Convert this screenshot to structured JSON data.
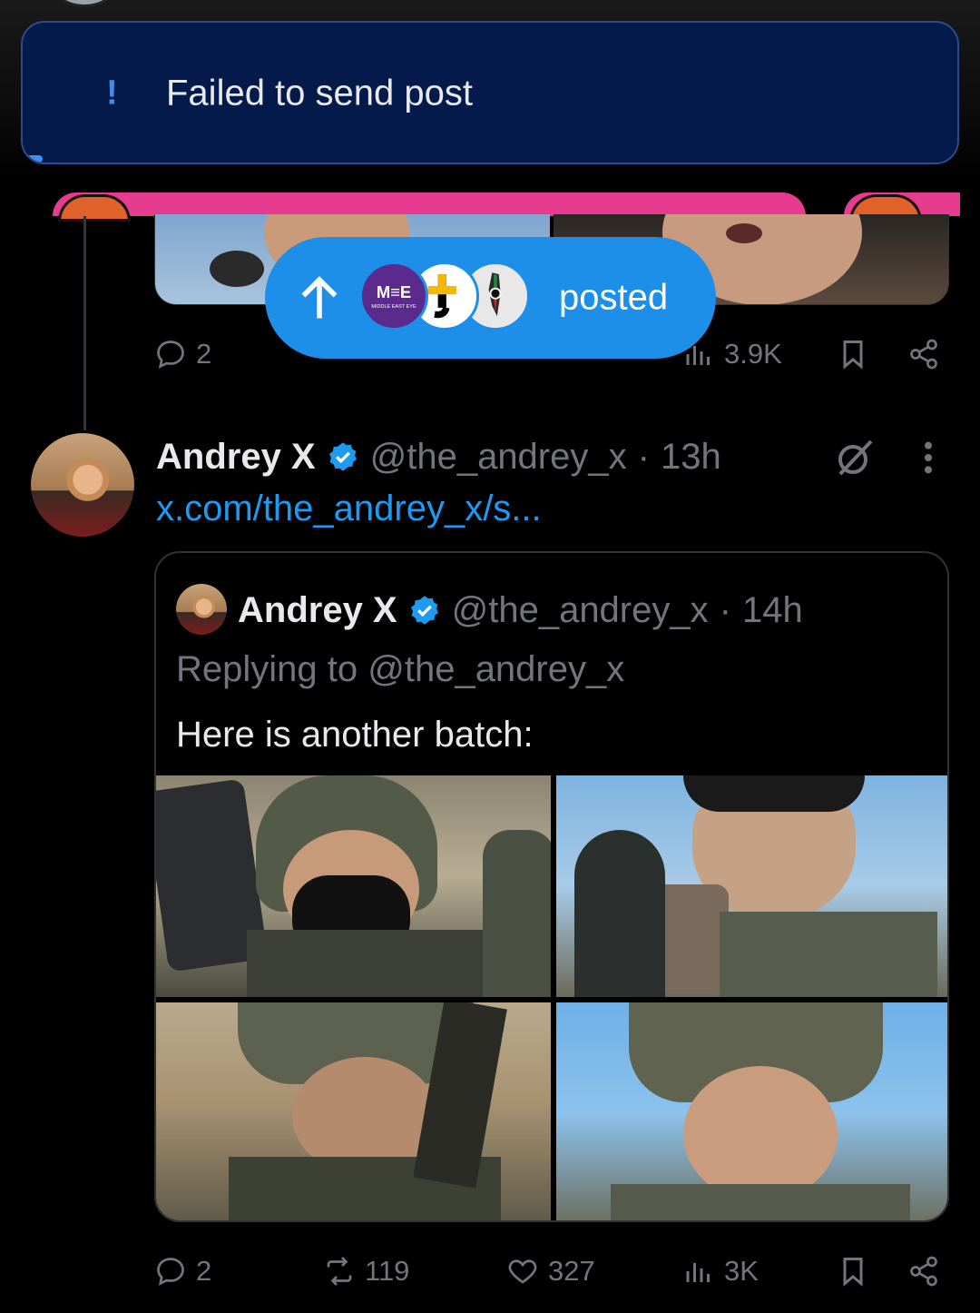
{
  "toast": {
    "icon": "exclamation-icon",
    "message": "Failed to send post"
  },
  "posted_pill": {
    "icon": "arrow-up-icon",
    "label": "posted",
    "avatars": [
      "MIDDLE EAST EYE",
      "AJ+",
      "palestine-map-icon"
    ],
    "mee_logo": "M≡E",
    "mee_sub": "MIDDLE EAST EYE"
  },
  "prev_post": {
    "replies": "2",
    "views": "3.9K"
  },
  "post": {
    "author_name": "Andrey X",
    "handle": "@the_andrey_x",
    "separator": "·",
    "time": "13h",
    "link": "x.com/the_andrey_x/s..."
  },
  "quote": {
    "author_name": "Andrey X",
    "handle": "@the_andrey_x",
    "separator": "·",
    "time": "14h",
    "replying_to": "Replying to @the_andrey_x",
    "text": "Here is another batch:"
  },
  "actions": {
    "replies": "2",
    "reposts": "119",
    "likes": "327",
    "views": "3K"
  },
  "colors": {
    "accent": "#1d9bf0",
    "toast_bg": "#041a4a",
    "pill_bg": "#1d8fe8",
    "muted": "#71767b"
  }
}
